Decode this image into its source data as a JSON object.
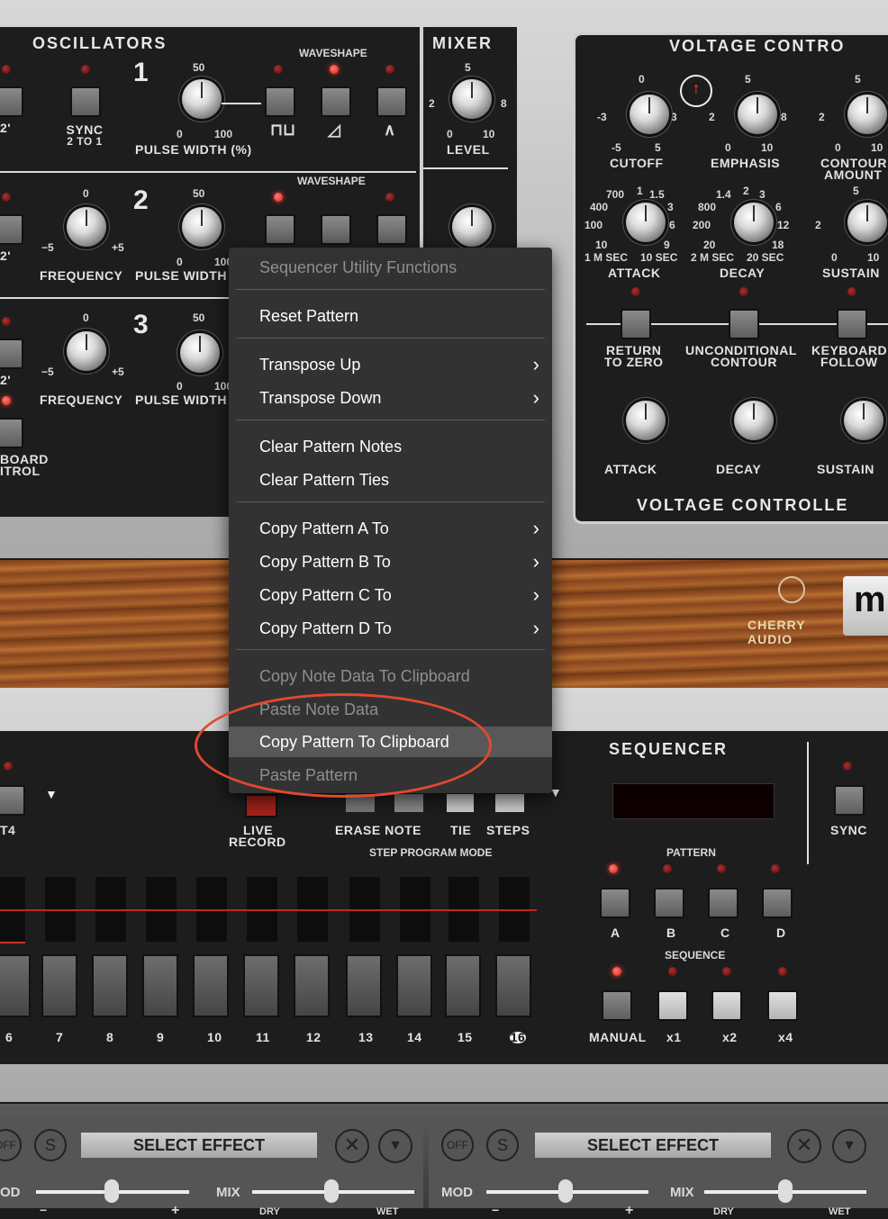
{
  "oscillators": {
    "title": "OSCILLATORS",
    "osc1": {
      "number": "1",
      "sync_label": "SYNC",
      "sync_sub": "2 TO 1",
      "pw_label": "PULSE WIDTH (%)",
      "pw_top": "50",
      "pw_min": "0",
      "pw_max": "100",
      "waveshape_label": "WAVESHAPE",
      "left_cut": "2'"
    },
    "osc2": {
      "number": "2",
      "freq_label": "FREQUENCY",
      "pw_label": "PULSE WIDTH",
      "freq_top": "0",
      "freq_min": "−5",
      "freq_max": "+5",
      "pw_top": "50",
      "pw_min": "0",
      "pw_max": "100",
      "waveshape_label": "WAVESHAPE",
      "left_cut": "2'"
    },
    "osc3": {
      "number": "3",
      "freq_label": "FREQUENCY",
      "pw_label": "PULSE WIDTH",
      "freq_top": "0",
      "freq_min": "−5",
      "freq_max": "+5",
      "pw_top": "50",
      "pw_min": "0",
      "pw_max": "100",
      "left_cut": "2'"
    },
    "board_control": "BOARD",
    "board_control2": "ITROL"
  },
  "mixer": {
    "title": "MIXER",
    "level_label": "LEVEL",
    "top": "5",
    "left": "2",
    "right": "8",
    "min": "0",
    "max": "10"
  },
  "vc": {
    "title": "VOLTAGE   CONTRO",
    "bottom_title": "VOLTAGE   CONTROLLE",
    "cutoff": {
      "label": "CUTOFF",
      "top": "0",
      "left": "-3",
      "right": "3",
      "min": "-5",
      "max": "5"
    },
    "emphasis": {
      "label": "EMPHASIS",
      "top": "5",
      "left": "2",
      "right": "8",
      "min": "0",
      "max": "10"
    },
    "contour": {
      "label": "CONTOUR",
      "label2": "AMOUNT",
      "top": "5",
      "left": "2",
      "min": "0",
      "max": "10"
    },
    "attack1": {
      "label": "ATTACK",
      "t1": "700",
      "t2": "1",
      "t3": "1.5",
      "l1": "400",
      "l2": "100",
      "l3": "10",
      "r1": "3",
      "r2": "6",
      "r3": "9",
      "bl": "1 M SEC",
      "br": "10 SEC"
    },
    "decay1": {
      "label": "DECAY",
      "t1": "1.4",
      "t2": "2",
      "t3": "3",
      "l1": "800",
      "l2": "200",
      "l3": "20",
      "r1": "6",
      "r2": "12",
      "r3": "18",
      "bl": "2 M SEC",
      "br": "20 SEC"
    },
    "sustain1": {
      "label": "SUSTAIN",
      "top": "5",
      "left": "2",
      "min": "0",
      "max": "10"
    },
    "return_zero": "RETURN",
    "return_zero2": "TO ZERO",
    "uncond": "UNCONDITIONAL",
    "uncond2": "CONTOUR",
    "keyboard": "KEYBOARD",
    "keyboard2": "FOLLOW",
    "attack2": {
      "label": "ATTACK"
    },
    "decay2": {
      "label": "DECAY"
    },
    "sustain2": {
      "label": "SUSTAIN"
    }
  },
  "logo": {
    "brand": "CHERRY AUDIO",
    "badge": "m"
  },
  "menu": {
    "header": "Sequencer Utility Functions",
    "items": [
      {
        "label": "Reset Pattern"
      },
      {
        "label": "Transpose Up"
      },
      {
        "label": "Transpose Down"
      },
      {
        "label": "Clear Pattern Notes"
      },
      {
        "label": "Clear Pattern Ties"
      },
      {
        "label": "Copy Pattern A To"
      },
      {
        "label": "Copy Pattern B To"
      },
      {
        "label": "Copy Pattern C To"
      },
      {
        "label": "Copy Pattern D To"
      },
      {
        "label": "Copy Note Data To Clipboard"
      },
      {
        "label": "Paste Note Data"
      },
      {
        "label": "Copy Pattern To Clipboard"
      },
      {
        "label": "Paste Pattern"
      }
    ],
    "submenu_arrow": "›"
  },
  "sequencer": {
    "title": "SEQUENCER",
    "t4": "T4",
    "live": "LIVE",
    "record": "RECORD",
    "erase_note": "ERASE NOTE",
    "tie": "TIE",
    "steps": "STEPS",
    "step_program_mode": "STEP PROGRAM MODE",
    "sync": "SYNC",
    "pattern_label": "PATTERN",
    "patterns": [
      "A",
      "B",
      "C",
      "D"
    ],
    "sequence_label": "SEQUENCE",
    "sequence": [
      "MANUAL",
      "x1",
      "x2",
      "x4"
    ],
    "step_numbers": [
      "6",
      "7",
      "8",
      "9",
      "10",
      "11",
      "12",
      "13",
      "14",
      "15",
      "16"
    ]
  },
  "effects": [
    {
      "off": "OFF",
      "s": "S",
      "select": "SELECT EFFECT",
      "mod": "OD",
      "mix": "MIX",
      "dry": "DRY",
      "wet": "WET",
      "minus": "−",
      "plus": "+"
    },
    {
      "off": "OFF",
      "s": "S",
      "select": "SELECT EFFECT",
      "mod": "MOD",
      "mix": "MIX",
      "dry": "DRY",
      "wet": "WET",
      "minus": "−",
      "plus": "+"
    }
  ]
}
